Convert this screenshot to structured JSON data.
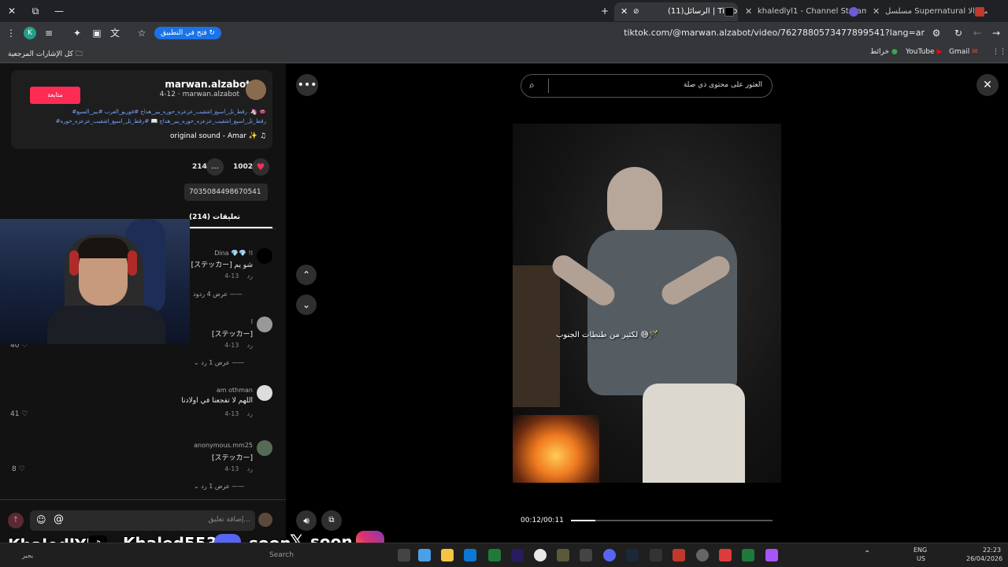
{
  "window": {
    "controls": [
      "✕",
      "⧉",
      "—"
    ]
  },
  "tabs": [
    {
      "label": "مسلسل Supernatural الموسم الا",
      "active": false
    },
    {
      "label": "khaledlyl1 - Channel Streams o",
      "active": false
    },
    {
      "label": "(11)الرسائل | TikTok",
      "active": true
    }
  ],
  "toolbar": {
    "url": "tiktok.com/@marwan.alzabot/video/7627880573477899541?lang=ar",
    "open_app": "فتح في التطبيق",
    "profile_letter": "K"
  },
  "bookmarks": {
    "all_bookmarks": "كل الإشارات المرجعية",
    "items": [
      "Gmail",
      "YouTube",
      "خرائط"
    ]
  },
  "post": {
    "username": "marwan.alzabot",
    "sub": "4-12 · marwan.alzabot",
    "follow": "متابعة",
    "caption_line1": "#رقط_تل_اسيع_اشقيب_عزعزه_حوره_بير_هداج #فوريو_العرب #بير_السبع .🦄 👄",
    "caption_line2": "#رقط_تل_اسيع_اشقيب_عزعزه_حوره_بير_هداج 📖 #رقط_تل_اسيع_اشقيب_عزعزه_حوره",
    "sound": "original sound - Amar ✨",
    "likes": "1002",
    "comments": "214",
    "link_fragment": "7035084498670541",
    "comments_tab": "تعليقات (214)"
  },
  "comments": [
    {
      "name": "Dina 💎💎 !ا",
      "text": "[ステッカー] شو يم",
      "date": "4-13",
      "reply": "رد",
      "view": "عرض 4 ردود",
      "likes": ""
    },
    {
      "name": "ا",
      "text": "[ステッカー]",
      "date": "4-13",
      "reply": "رد",
      "view": "عرض 1 رد",
      "likes": "40"
    },
    {
      "name": "am othman",
      "text": "اللهم لا تفجعنا في اولادنا",
      "date": "4-13",
      "reply": "رد",
      "view": "",
      "likes": "41"
    },
    {
      "name": "anonymous.mm25",
      "text": "[ステッカー]",
      "date": "4-13",
      "reply": "رد",
      "view": "عرض 1 رد",
      "likes": "8"
    }
  ],
  "comment_input": {
    "placeholder": "إضافة تعليق..."
  },
  "video": {
    "search_placeholder": "العثور على محتوى ذي صلة",
    "overlay_caption": "لكثير من طنطات الجنوب 😅🪄",
    "time": "00:12/00:11",
    "progress": 0.12
  },
  "stream_overlay": {
    "handle1": "KhaledlYl1",
    "handle2": "Khaled5534",
    "soon1": "soon",
    "soon2": "soon"
  },
  "taskbar": {
    "search": "Search",
    "lang": "ENG",
    "region": "US",
    "time": "22:23",
    "date": "26/04/2026",
    "weather": "بحير"
  }
}
